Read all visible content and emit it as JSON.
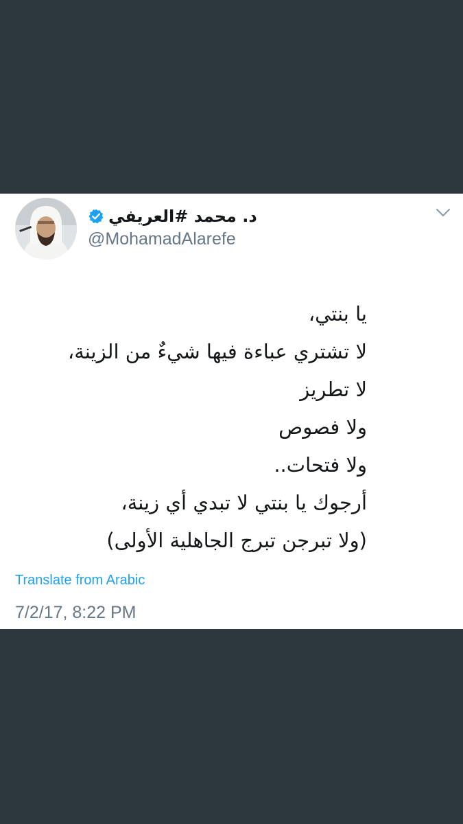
{
  "tweet": {
    "author": {
      "display_name": "د. محمد #العريفي",
      "handle": "@MohamadAlarefe",
      "verified": true,
      "avatar_icon": "profile-photo"
    },
    "menu_icon": "chevron-down-icon",
    "lines": [
      "يا بنتي،",
      "لا تشتري عباءة فيها شيءٌ من الزينة،",
      "لا تطريز",
      "ولا فصوص",
      "ولا فتحات..",
      "أرجوك يا بنتي لا تبدي أي زينة،",
      "(ولا تبرجن تبرج الجاهلية الأولى)"
    ],
    "translate_label": "Translate from Arabic",
    "timestamp": "7/2/17, 8:22 PM"
  },
  "colors": {
    "background": "#2c373e",
    "card": "#ffffff",
    "text": "#14171a",
    "secondary_text": "#657786",
    "link": "#1da1f2",
    "verified": "#1da1f2"
  }
}
